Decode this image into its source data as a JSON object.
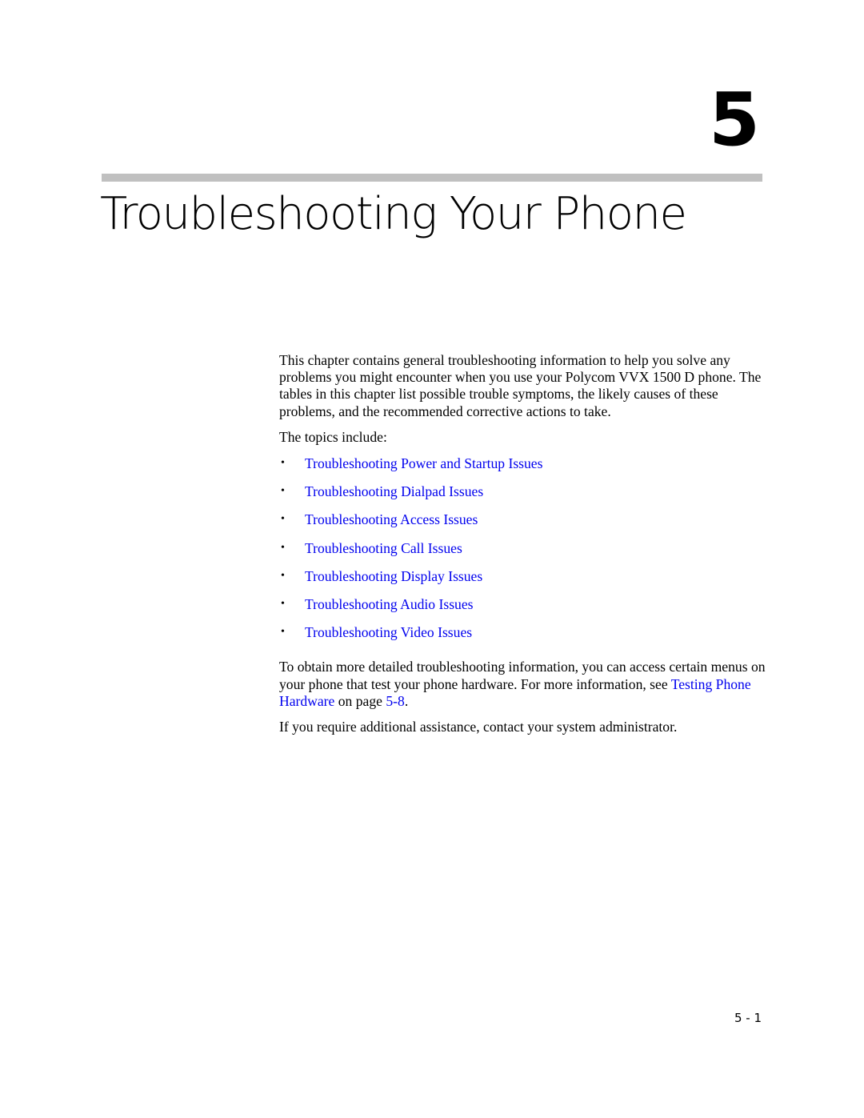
{
  "chapter": {
    "number": "5",
    "title": "Troubleshooting Your Phone"
  },
  "intro": {
    "paragraph": "This chapter contains general troubleshooting information to help you solve any problems you might encounter when you use your Polycom VVX 1500 D phone. The tables in this chapter list possible trouble symptoms, the likely causes of these problems, and the recommended corrective actions to take.",
    "topics_lead": "The topics include:"
  },
  "topics": [
    {
      "bullet": "•",
      "label": "Troubleshooting Power and Startup Issues"
    },
    {
      "bullet": "•",
      "label": "Troubleshooting Dialpad Issues"
    },
    {
      "bullet": "•",
      "label": "Troubleshooting Access Issues"
    },
    {
      "bullet": "•",
      "label": "Troubleshooting Call Issues"
    },
    {
      "bullet": "•",
      "label": "Troubleshooting Display Issues"
    },
    {
      "bullet": "•",
      "label": "Troubleshooting Audio Issues"
    },
    {
      "bullet": "•",
      "label": "Troubleshooting Video Issues"
    }
  ],
  "hardware_note": {
    "text_before": "To obtain more detailed troubleshooting information, you can access certain menus on your phone that test your phone hardware. For more information, see ",
    "link_label": "Testing Phone Hardware",
    "text_middle": " on page ",
    "page_link": "5-8",
    "text_after": "."
  },
  "closing": "If you require additional assistance, contact your system administrator.",
  "footer": {
    "page_number": "5 - 1"
  },
  "colors": {
    "link": "#0000ee",
    "rule": "#c0c0c0",
    "text": "#000000"
  }
}
